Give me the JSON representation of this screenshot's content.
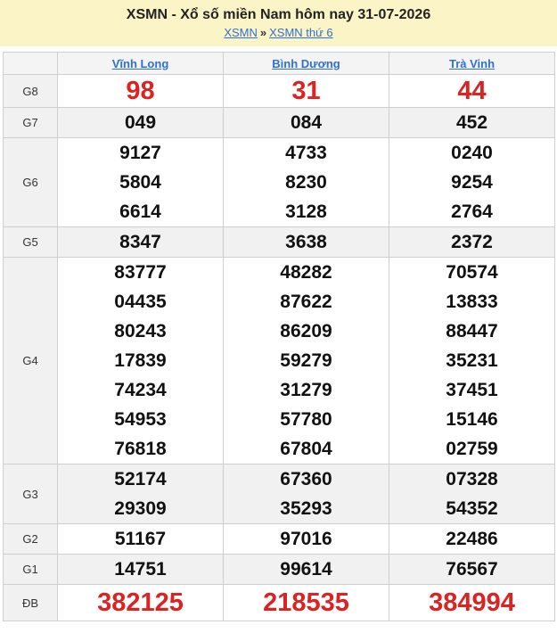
{
  "header": {
    "title": "XSMN - Xổ số miền Nam hôm nay 31-07-2026",
    "link1": "XSMN",
    "separator": "»",
    "link2": "XSMN thứ 6"
  },
  "provinces": [
    "Vĩnh Long",
    "Bình Dương",
    "Trà Vinh"
  ],
  "rows": [
    {
      "label": "G8",
      "values": [
        [
          "98"
        ],
        [
          "31"
        ],
        [
          "44"
        ]
      ]
    },
    {
      "label": "G7",
      "values": [
        [
          "049"
        ],
        [
          "084"
        ],
        [
          "452"
        ]
      ]
    },
    {
      "label": "G6",
      "values": [
        [
          "9127",
          "5804",
          "6614"
        ],
        [
          "4733",
          "8230",
          "3128"
        ],
        [
          "0240",
          "9254",
          "2764"
        ]
      ]
    },
    {
      "label": "G5",
      "values": [
        [
          "8347"
        ],
        [
          "3638"
        ],
        [
          "2372"
        ]
      ]
    },
    {
      "label": "G4",
      "values": [
        [
          "83777",
          "04435",
          "80243",
          "17839",
          "74234",
          "54953",
          "76818"
        ],
        [
          "48282",
          "87622",
          "86209",
          "59279",
          "31279",
          "57780",
          "67804"
        ],
        [
          "70574",
          "13833",
          "88447",
          "35231",
          "37451",
          "15146",
          "02759"
        ]
      ]
    },
    {
      "label": "G3",
      "values": [
        [
          "52174",
          "29309"
        ],
        [
          "67360",
          "35293"
        ],
        [
          "07328",
          "54352"
        ]
      ]
    },
    {
      "label": "G2",
      "values": [
        [
          "51167"
        ],
        [
          "97016"
        ],
        [
          "22486"
        ]
      ]
    },
    {
      "label": "G1",
      "values": [
        [
          "14751"
        ],
        [
          "99614"
        ],
        [
          "76567"
        ]
      ]
    },
    {
      "label": "ĐB",
      "values": [
        [
          "382125"
        ],
        [
          "218535"
        ],
        [
          "384994"
        ]
      ]
    }
  ],
  "colors": {
    "header_bg": "#fbf4c6",
    "link": "#2f6fd6",
    "highlight": "#dd2222"
  }
}
